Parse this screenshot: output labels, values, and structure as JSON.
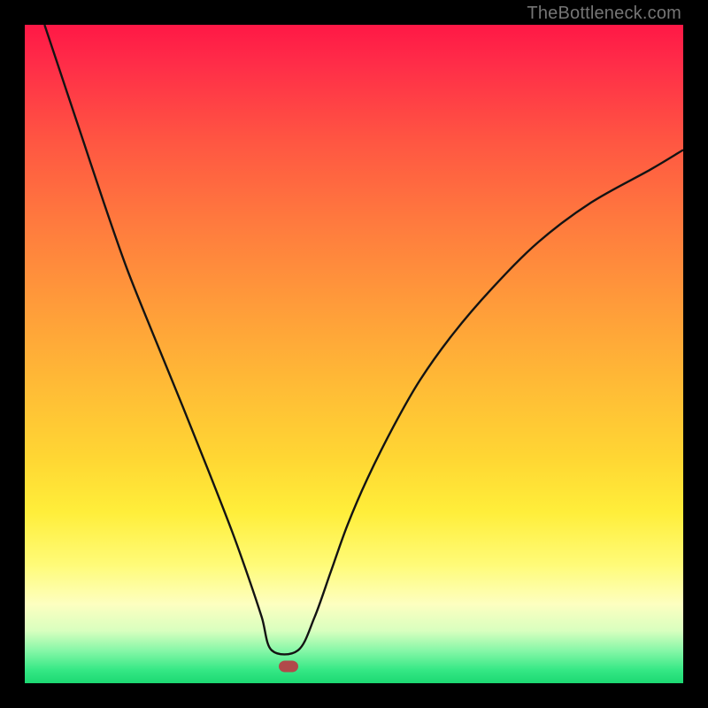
{
  "attribution": "TheBottleneck.com",
  "colors": {
    "page_bg": "#000000",
    "gradient_stops": [
      {
        "pct": 0,
        "hex": "#ff1846"
      },
      {
        "pct": 6,
        "hex": "#ff2d48"
      },
      {
        "pct": 18,
        "hex": "#ff5742"
      },
      {
        "pct": 30,
        "hex": "#ff7a3e"
      },
      {
        "pct": 42,
        "hex": "#ff9a3a"
      },
      {
        "pct": 54,
        "hex": "#ffb936"
      },
      {
        "pct": 66,
        "hex": "#ffd733"
      },
      {
        "pct": 74,
        "hex": "#ffee3a"
      },
      {
        "pct": 82,
        "hex": "#fffb78"
      },
      {
        "pct": 88,
        "hex": "#fdffc0"
      },
      {
        "pct": 92,
        "hex": "#d9ffbf"
      },
      {
        "pct": 95,
        "hex": "#88f7a8"
      },
      {
        "pct": 98,
        "hex": "#35e885"
      },
      {
        "pct": 100,
        "hex": "#1cd872"
      }
    ],
    "curve_stroke": "#131313",
    "marker_fill": "#b14a4a"
  },
  "marker": {
    "x_frac": 0.4,
    "y_frac": 0.975
  },
  "chart_data": {
    "type": "line",
    "title": "",
    "xlabel": "",
    "ylabel": "",
    "xlim": [
      0,
      100
    ],
    "ylim": [
      0,
      100
    ],
    "grid": false,
    "note": "V-shaped bottleneck curve; minimum (optimal balance) near x≈40. Color gradient encodes severity: red=high, green=low.",
    "x": [
      3,
      6,
      9,
      12,
      15.5,
      19.5,
      24,
      28,
      31.5,
      34,
      36,
      37.5,
      41.5,
      44,
      46.5,
      49,
      52,
      56,
      60,
      65,
      71,
      78,
      86,
      95,
      100
    ],
    "y": [
      100,
      91,
      82,
      73,
      63,
      53,
      42,
      32,
      23,
      16,
      10,
      5,
      5,
      10,
      17,
      24,
      31,
      39,
      46,
      53,
      60,
      67,
      73,
      78,
      81
    ],
    "series": [
      {
        "name": "bottleneck-curve",
        "x": [
          3,
          6,
          9,
          12,
          15.5,
          19.5,
          24,
          28,
          31.5,
          34,
          36,
          37.5,
          41.5,
          44,
          46.5,
          49,
          52,
          56,
          60,
          65,
          71,
          78,
          86,
          95,
          100
        ],
        "y": [
          100,
          91,
          82,
          73,
          63,
          53,
          42,
          32,
          23,
          16,
          10,
          5,
          5,
          10,
          17,
          24,
          31,
          39,
          46,
          53,
          60,
          67,
          73,
          78,
          81
        ]
      }
    ],
    "marker_point": {
      "x": 40,
      "y": 2.5
    }
  }
}
